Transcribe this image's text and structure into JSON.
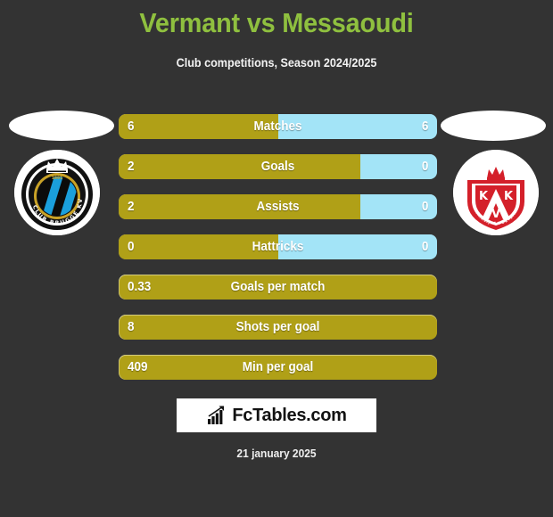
{
  "header": {
    "title": "Vermant vs Messaoudi",
    "subtitle": "Club competitions, Season 2024/2025",
    "title_color": "#8fc03f"
  },
  "teams": {
    "home": {
      "badge_name": "club-brugge-badge",
      "badge_alt": "Club Brugge KV"
    },
    "away": {
      "badge_name": "kv-kortrijk-badge",
      "badge_alt": "KV Kortrijk"
    }
  },
  "colors": {
    "background": "#333333",
    "home_bar": "#b0a017",
    "away_bar": "#a3e4f7",
    "accent_green": "#8fc03f"
  },
  "chart_data": {
    "type": "bar",
    "title": "Vermant vs Messaoudi",
    "subtitle": "Club competitions, Season 2024/2025",
    "orientation": "horizontal-diverging",
    "series": [
      {
        "name": "Vermant",
        "color": "#b0a017"
      },
      {
        "name": "Messaoudi",
        "color": "#a3e4f7"
      }
    ],
    "categories": [
      "Matches",
      "Goals",
      "Assists",
      "Hattricks",
      "Goals per match",
      "Shots per goal",
      "Min per goal"
    ],
    "rows": [
      {
        "label": "Matches",
        "home": "6",
        "away": "6",
        "home_pct": 50,
        "split": true
      },
      {
        "label": "Goals",
        "home": "2",
        "away": "0",
        "home_pct": 76,
        "split": true
      },
      {
        "label": "Assists",
        "home": "2",
        "away": "0",
        "home_pct": 76,
        "split": true
      },
      {
        "label": "Hattricks",
        "home": "0",
        "away": "0",
        "home_pct": 50,
        "split": true
      },
      {
        "label": "Goals per match",
        "home": "0.33",
        "away": "",
        "home_pct": 100,
        "split": false
      },
      {
        "label": "Shots per goal",
        "home": "8",
        "away": "",
        "home_pct": 100,
        "split": false
      },
      {
        "label": "Min per goal",
        "home": "409",
        "away": "",
        "home_pct": 100,
        "split": false
      }
    ]
  },
  "footer": {
    "logo_text": "FcTables.com",
    "logo_icon": "bar-chart-arrow-icon",
    "date": "21 january 2025"
  }
}
